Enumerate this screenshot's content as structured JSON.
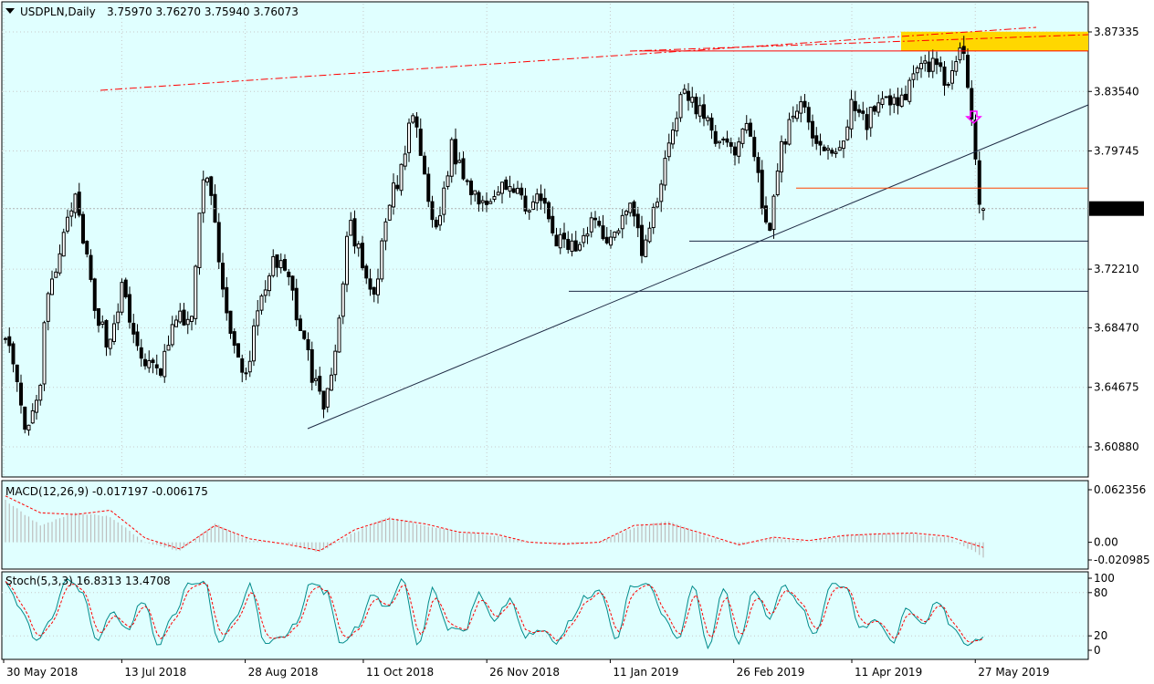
{
  "header": {
    "title": "USDPLN,Daily",
    "ohlc": "3.75970 3.76270 3.75940 3.76073"
  },
  "colors": {
    "background": "#e0ffff",
    "candle": "#000000",
    "grid": "#c8c8c8",
    "trendline": "#1e2a44",
    "resistance_dashed": "#ff0000",
    "support_orange": "#ff4500",
    "zone": "#ffd700",
    "price_label_bg": "#000000",
    "arrow": "#ff00ff",
    "macd_hist": "#bdbdbd",
    "macd_signal": "#ff0000",
    "stoch_main": "#008b8b",
    "stoch_signal": "#ff0000"
  },
  "price_axis": {
    "ticks": [
      "3.87335",
      "3.83540",
      "3.79745",
      "3.72210",
      "3.68470",
      "3.64675",
      "3.60880"
    ],
    "current_price": "3.76073"
  },
  "time_axis": {
    "labels": [
      "30 May 2018",
      "13 Jul 2018",
      "28 Aug 2018",
      "11 Oct 2018",
      "26 Nov 2018",
      "11 Jan 2019",
      "26 Feb 2019",
      "11 Apr 2019",
      "27 May 2019"
    ]
  },
  "macd": {
    "label": "MACD(12,26,9) -0.017197 -0.006175",
    "ticks": [
      "0.062356",
      "0.00",
      "-0.020985"
    ]
  },
  "stoch": {
    "label": "Stoch(5,3,3) 16.8313 13.4708",
    "ticks": [
      "100",
      "80",
      "20",
      "0"
    ]
  },
  "chart_data": [
    {
      "type": "candlestick",
      "title": "USDPLN,Daily",
      "ylim": [
        3.585,
        3.885
      ],
      "x_range": [
        "30 May 2018",
        "31 May 2019"
      ],
      "anchor_closes": [
        [
          "30 May 2018",
          3.69
        ],
        [
          "04 Jun 2018",
          3.645
        ],
        [
          "07 Jun 2018",
          3.615
        ],
        [
          "12 Jun 2018",
          3.638
        ],
        [
          "15 Jun 2018",
          3.7
        ],
        [
          "20 Jun 2018",
          3.73
        ],
        [
          "25 Jun 2018",
          3.77
        ],
        [
          "28 Jun 2018",
          3.745
        ],
        [
          "03 Jul 2018",
          3.7
        ],
        [
          "08 Jul 2018",
          3.672
        ],
        [
          "13 Jul 2018",
          3.71
        ],
        [
          "18 Jul 2018",
          3.675
        ],
        [
          "23 Jul 2018",
          3.66
        ],
        [
          "27 Jul 2018",
          3.655
        ],
        [
          "02 Aug 2018",
          3.69
        ],
        [
          "08 Aug 2018",
          3.69
        ],
        [
          "13 Aug 2018",
          3.795
        ],
        [
          "16 Aug 2018",
          3.76
        ],
        [
          "22 Aug 2018",
          3.68
        ],
        [
          "28 Aug 2018",
          3.65
        ],
        [
          "02 Sep 2018",
          3.7
        ],
        [
          "07 Sep 2018",
          3.725
        ],
        [
          "12 Sep 2018",
          3.72
        ],
        [
          "17 Sep 2018",
          3.69
        ],
        [
          "22 Sep 2018",
          3.655
        ],
        [
          "27 Sep 2018",
          3.633
        ],
        [
          "02 Oct 2018",
          3.69
        ],
        [
          "06 Oct 2018",
          3.755
        ],
        [
          "11 Oct 2018",
          3.72
        ],
        [
          "15 Oct 2018",
          3.7
        ],
        [
          "20 Oct 2018",
          3.76
        ],
        [
          "25 Oct 2018",
          3.785
        ],
        [
          "30 Oct 2018",
          3.825
        ],
        [
          "03 Nov 2018",
          3.775
        ],
        [
          "07 Nov 2018",
          3.745
        ],
        [
          "13 Nov 2018",
          3.8
        ],
        [
          "19 Nov 2018",
          3.775
        ],
        [
          "26 Nov 2018",
          3.765
        ],
        [
          "02 Dec 2018",
          3.78
        ],
        [
          "09 Dec 2018",
          3.765
        ],
        [
          "16 Dec 2018",
          3.765
        ],
        [
          "22 Dec 2018",
          3.74
        ],
        [
          "29 Dec 2018",
          3.735
        ],
        [
          "04 Jan 2019",
          3.755
        ],
        [
          "11 Jan 2019",
          3.74
        ],
        [
          "15 Jan 2019",
          3.755
        ],
        [
          "19 Jan 2019",
          3.77
        ],
        [
          "23 Jan 2019",
          3.73
        ],
        [
          "29 Jan 2019",
          3.77
        ],
        [
          "04 Feb 2019",
          3.82
        ],
        [
          "08 Feb 2019",
          3.835
        ],
        [
          "14 Feb 2019",
          3.82
        ],
        [
          "20 Feb 2019",
          3.805
        ],
        [
          "26 Feb 2019",
          3.795
        ],
        [
          "02 Mar 2019",
          3.82
        ],
        [
          "06 Mar 2019",
          3.79
        ],
        [
          "11 Mar 2019",
          3.745
        ],
        [
          "16 Mar 2019",
          3.8
        ],
        [
          "22 Mar 2019",
          3.83
        ],
        [
          "28 Mar 2019",
          3.805
        ],
        [
          "03 Apr 2019",
          3.795
        ],
        [
          "08 Apr 2019",
          3.805
        ],
        [
          "11 Apr 2019",
          3.83
        ],
        [
          "16 Apr 2019",
          3.815
        ],
        [
          "21 Apr 2019",
          3.83
        ],
        [
          "26 Apr 2019",
          3.825
        ],
        [
          "01 May 2019",
          3.835
        ],
        [
          "07 May 2019",
          3.85
        ],
        [
          "12 May 2019",
          3.855
        ],
        [
          "17 May 2019",
          3.84
        ],
        [
          "22 May 2019",
          3.86
        ],
        [
          "25 May 2019",
          3.835
        ],
        [
          "27 May 2019",
          3.8
        ],
        [
          "29 May 2019",
          3.76
        ],
        [
          "31 May 2019",
          3.76073
        ]
      ],
      "horizontal_levels": [
        3.7738,
        3.74,
        3.708
      ],
      "resistance_zone": [
        3.8612,
        3.8735
      ]
    },
    {
      "type": "line",
      "title": "MACD(12,26,9)",
      "series": [
        {
          "name": "-0.017197",
          "style": "histogram"
        },
        {
          "name": "-0.006175",
          "style": "dashed"
        }
      ],
      "ylim": [
        -0.020985,
        0.062356
      ],
      "anchor_values": [
        [
          0.05,
          0.055
        ],
        [
          0.02,
          0.035
        ],
        [
          0.035,
          0.033
        ],
        [
          0.03,
          0.038
        ],
        [
          0.0,
          0.005
        ],
        [
          -0.01,
          -0.008
        ],
        [
          0.022,
          0.02
        ],
        [
          0.002,
          0.004
        ],
        [
          0.0,
          -0.002
        ],
        [
          -0.012,
          -0.01
        ],
        [
          0.012,
          0.015
        ],
        [
          0.03,
          0.028
        ],
        [
          0.02,
          0.022
        ],
        [
          0.012,
          0.012
        ],
        [
          0.008,
          0.01
        ],
        [
          0.0,
          0.0
        ],
        [
          -0.002,
          -0.002
        ],
        [
          0.0,
          0.0
        ],
        [
          0.018,
          0.02
        ],
        [
          0.025,
          0.022
        ],
        [
          0.008,
          0.01
        ],
        [
          -0.004,
          -0.003
        ],
        [
          0.005,
          0.006
        ],
        [
          0.0,
          0.002
        ],
        [
          0.008,
          0.008
        ],
        [
          0.01,
          0.01
        ],
        [
          0.01,
          0.011
        ],
        [
          0.005,
          0.007
        ],
        [
          -0.017197,
          -0.006175
        ]
      ]
    },
    {
      "type": "line",
      "title": "Stoch(5,3,3)",
      "series": [
        {
          "name": "16.8313"
        },
        {
          "name": "13.4708"
        }
      ],
      "ylim": [
        0,
        100
      ],
      "levels": [
        80,
        20
      ],
      "anchor_values": [
        95,
        60,
        10,
        40,
        100,
        80,
        15,
        55,
        30,
        70,
        10,
        45,
        90,
        95,
        10,
        40,
        90,
        10,
        15,
        35,
        95,
        80,
        10,
        30,
        75,
        60,
        100,
        5,
        85,
        30,
        25,
        80,
        40,
        70,
        20,
        30,
        10,
        40,
        75,
        80,
        15,
        90,
        95,
        50,
        15,
        90,
        5,
        85,
        10,
        85,
        45,
        90,
        60,
        20,
        90,
        90,
        30,
        45,
        10,
        60,
        35,
        70,
        30,
        10,
        16.8
      ]
    }
  ]
}
